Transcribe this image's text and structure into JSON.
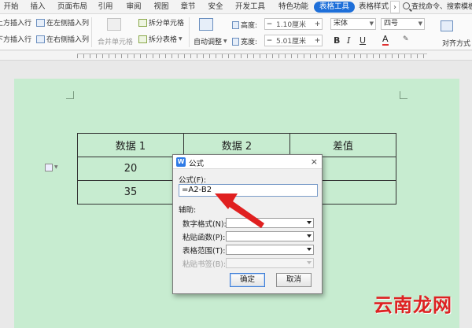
{
  "tabs": [
    "开始",
    "插入",
    "页面布局",
    "引用",
    "审阅",
    "视图",
    "章节",
    "安全",
    "开发工具",
    "特色功能",
    "表格工具",
    "表格样式"
  ],
  "active_tab": "表格工具",
  "search_text": "查找命令、搜索模板",
  "ribbon": {
    "insert_row_above": "在上方插入行",
    "insert_row_below": "在下方插入行",
    "insert_col_left": "在左侧插入列",
    "insert_col_right": "在右侧插入列",
    "merge_cells": "合并单元格",
    "split_cells": "拆分单元格",
    "split_table": "拆分表格",
    "auto_fit": "自动调整",
    "height_label": "高度:",
    "height_value": "1.10厘米",
    "width_label": "宽度:",
    "width_value": "5.01厘米",
    "font_name": "宋体",
    "font_size": "四号",
    "bold": "B",
    "italic": "I",
    "underline": "U",
    "font_color": "A",
    "align": "对齐方式"
  },
  "table": [
    [
      "数据 1",
      "数据 2",
      "差值"
    ],
    [
      "20",
      "",
      ""
    ],
    [
      "35",
      "",
      ""
    ]
  ],
  "dialog": {
    "title": "公式",
    "close": "×",
    "formula_label": "公式(F):",
    "formula_value": "=A2-B2",
    "aux_label": "辅助:",
    "number_format_label": "数字格式(N):",
    "paste_function_label": "粘贴函数(P):",
    "table_range_label": "表格范围(T):",
    "paste_bookmark_label": "粘贴书签(B):",
    "ok": "确定",
    "cancel": "取消"
  },
  "watermark": "云南龙网",
  "colors": {
    "accent": "#1e6fd9",
    "page_bg": "#c7ecd0",
    "arrow": "#e02020"
  }
}
